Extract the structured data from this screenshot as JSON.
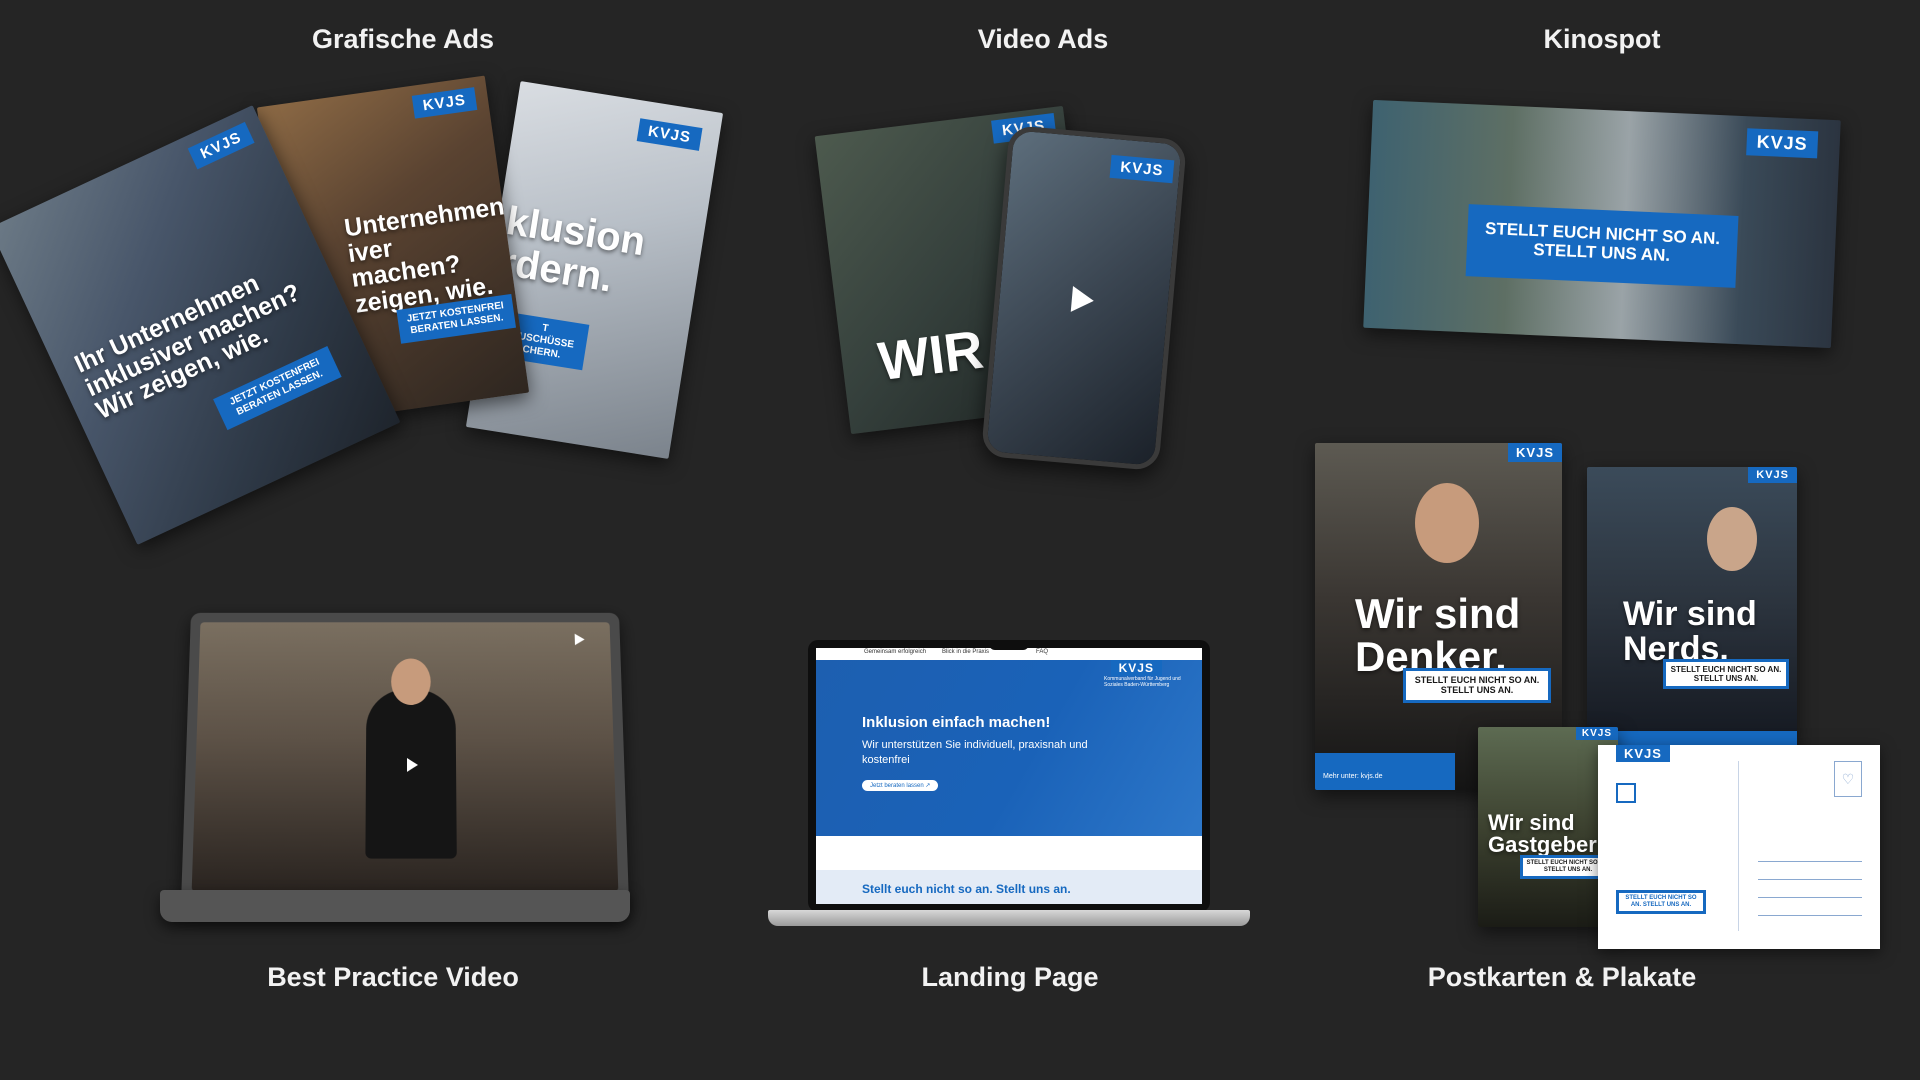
{
  "sections": {
    "grafische_ads": "Grafische Ads",
    "video_ads": "Video Ads",
    "kinospot": "Kinospot",
    "best_practice": "Best Practice Video",
    "landing_page": "Landing Page",
    "postkarten": "Postkarten & Plakate"
  },
  "brand": "KVJS",
  "colors": {
    "background": "#252525",
    "brand_blue": "#1669c0"
  },
  "grafische_ads": {
    "ad1_headline": "Ihr Unternehmen inklusiver machen? Wir zeigen, wie.",
    "ad1_cta": "JETZT KOSTENFREI BERATEN LASSEN.",
    "ad2_headline": "Unternehmen iver machen? zeigen, wie.",
    "ad2_cta": "JETZT KOSTENFREI BERATEN LASSEN.",
    "ad3_headline": "klusion rdern.",
    "ad3_cta": "T ZUSCHÜSSE CHERN."
  },
  "video_ads": {
    "word": "WIR",
    "play_icon": "play-icon"
  },
  "kinospot": {
    "bubble": "STELLT EUCH NICHT SO AN. STELLT UNS AN."
  },
  "landing": {
    "nav": [
      "Gemeinsam erfolgreich",
      "Blick in die Praxis",
      "FAQ"
    ],
    "org_text": "Kommunalverband für Jugend und Soziales Baden-Württemberg",
    "hero_title": "Inklusion einfach machen!",
    "hero_text": "Wir unterstützen Sie individuell, praxisnah und kostenfrei",
    "hero_button": "Jetzt beraten lassen ↗",
    "footer_text": "Stellt euch nicht so an. Stellt uns an."
  },
  "plakate": {
    "p1_headline": "Wir sind Denker.",
    "p2_headline": "Wir sind Nerds.",
    "p3_headline": "Wir sind Gastgeber",
    "bubble": "STELLT EUCH NICHT SO AN. STELLT UNS AN.",
    "url": "Mehr unter: kvjs.de"
  }
}
